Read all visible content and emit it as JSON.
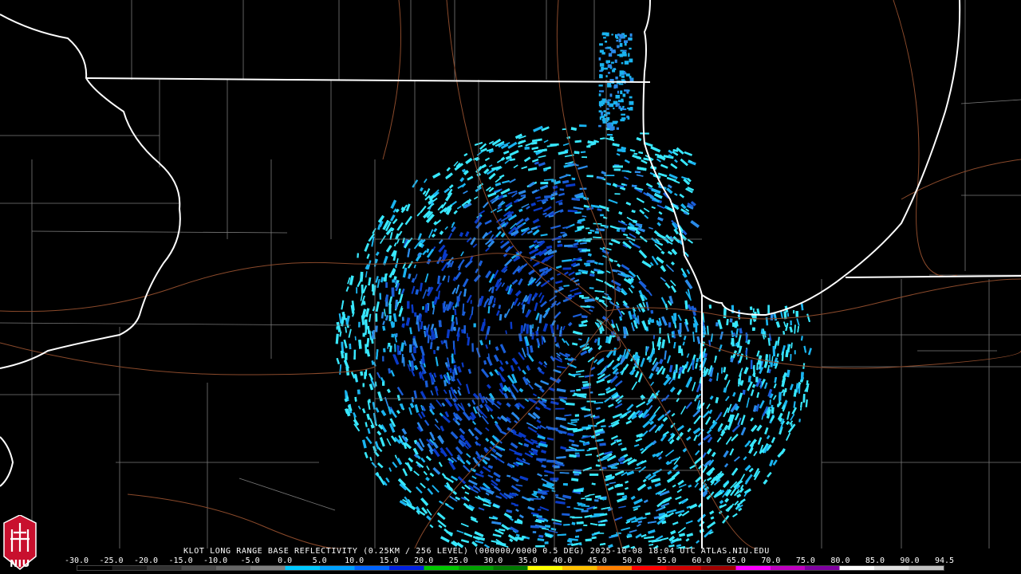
{
  "product": {
    "caption": "KLOT LONG RANGE BASE REFLECTIVITY (0.25KM / 256 LEVEL) (000000/0000 0.5 DEG) 2025-10-08 18:04 UTC  ATLAS.NIU.EDU"
  },
  "logo": {
    "text": "NIU",
    "icon": "castle-icon",
    "color": "#c8102e"
  },
  "legend": {
    "labels": [
      "-30.0",
      "-25.0",
      "-20.0",
      "-15.0",
      "-10.0",
      "-5.0",
      "0.0",
      "5.0",
      "10.0",
      "15.0",
      "20.0",
      "25.0",
      "30.0",
      "35.0",
      "40.0",
      "45.0",
      "50.0",
      "55.0",
      "60.0",
      "65.0",
      "70.0",
      "75.0",
      "80.0",
      "85.0",
      "90.0",
      "94.5"
    ],
    "colors": [
      "#000000",
      "#1a1a1a",
      "#333333",
      "#4d4d4d",
      "#666666",
      "#808080",
      "#00c8ff",
      "#00a0ff",
      "#0064ff",
      "#0020e0",
      "#00c800",
      "#00a000",
      "#007800",
      "#ffff00",
      "#ffc000",
      "#ff8000",
      "#ff0000",
      "#d00000",
      "#a00000",
      "#ff00ff",
      "#c000c0",
      "#8000a0",
      "#ffffff",
      "#e0e0e0",
      "#c0c0c0"
    ]
  },
  "radar": {
    "site": "KLOT",
    "colors": [
      "#38e8ff",
      "#1ab4f0",
      "#2a8ae8",
      "#1a5ed8",
      "#0a3ac8"
    ]
  }
}
